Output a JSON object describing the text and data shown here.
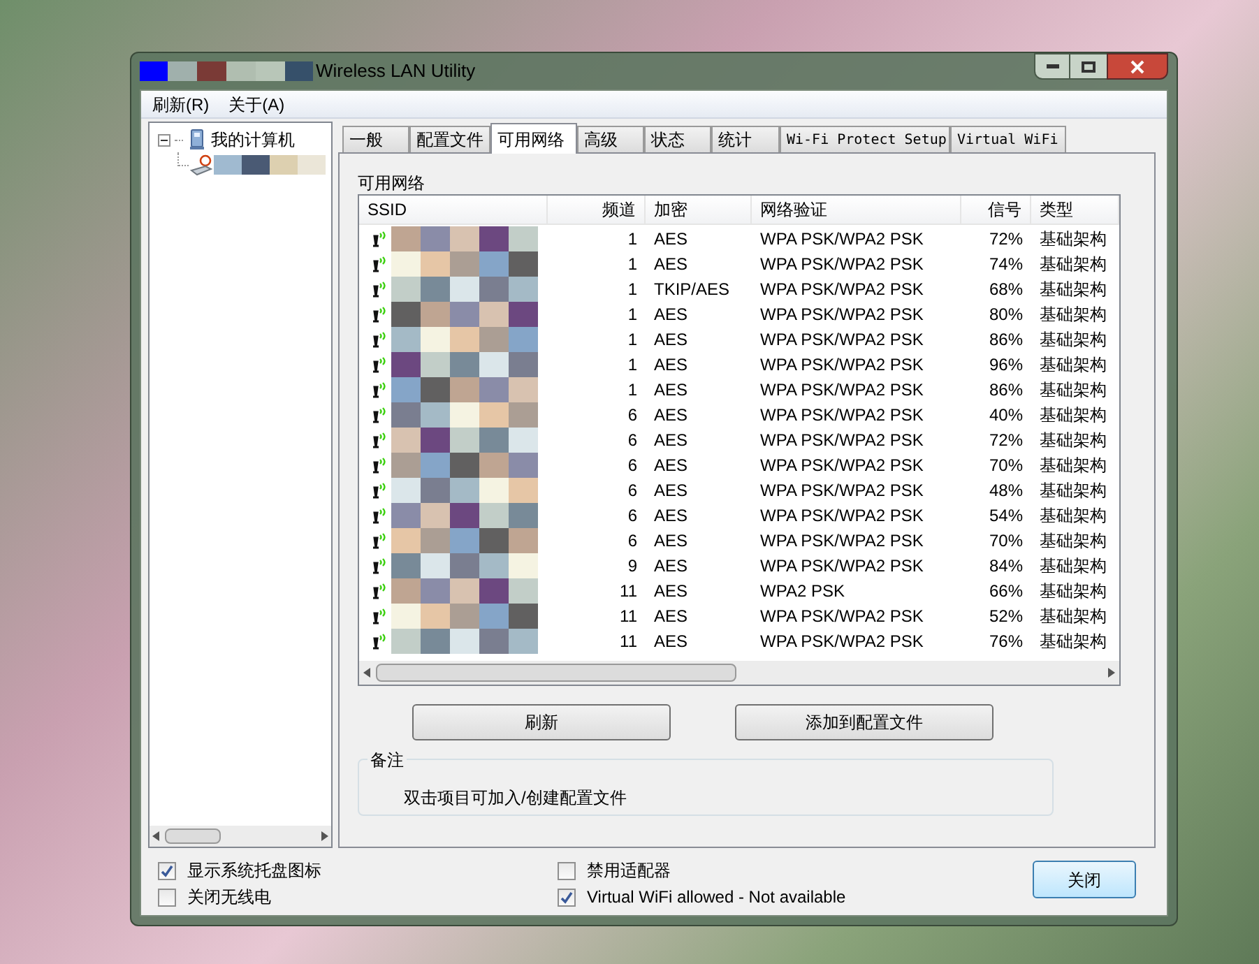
{
  "window": {
    "title": "Wireless LAN Utility"
  },
  "menu": [
    {
      "label": "刷新(R)"
    },
    {
      "label": "关于(A)"
    }
  ],
  "tree": {
    "label": "我的计算机",
    "expanded": true,
    "children": [
      {
        "kind": "adapter"
      }
    ]
  },
  "tabs": [
    {
      "label": "一般",
      "selected": false
    },
    {
      "label": "配置文件",
      "selected": false
    },
    {
      "label": "可用网络",
      "selected": true
    },
    {
      "label": "高级",
      "selected": false
    },
    {
      "label": "状态",
      "selected": false
    },
    {
      "label": "统计",
      "selected": false
    },
    {
      "label": "Wi-Fi Protect Setup",
      "selected": false
    },
    {
      "label": "Virtual WiFi",
      "selected": false
    }
  ],
  "panel_title": "可用网络",
  "table": {
    "columns": [
      "SSID",
      "频道",
      "加密",
      "网络验证",
      "信号",
      "类型"
    ],
    "rows": [
      {
        "channel": "1",
        "encryption": "AES",
        "auth": "WPA PSK/WPA2 PSK",
        "signal": "72%",
        "type": "基础架构"
      },
      {
        "channel": "1",
        "encryption": "AES",
        "auth": "WPA PSK/WPA2 PSK",
        "signal": "74%",
        "type": "基础架构"
      },
      {
        "channel": "1",
        "encryption": "TKIP/AES",
        "auth": "WPA PSK/WPA2 PSK",
        "signal": "68%",
        "type": "基础架构"
      },
      {
        "channel": "1",
        "encryption": "AES",
        "auth": "WPA PSK/WPA2 PSK",
        "signal": "80%",
        "type": "基础架构"
      },
      {
        "channel": "1",
        "encryption": "AES",
        "auth": "WPA PSK/WPA2 PSK",
        "signal": "86%",
        "type": "基础架构"
      },
      {
        "channel": "1",
        "encryption": "AES",
        "auth": "WPA PSK/WPA2 PSK",
        "signal": "96%",
        "type": "基础架构"
      },
      {
        "channel": "1",
        "encryption": "AES",
        "auth": "WPA PSK/WPA2 PSK",
        "signal": "86%",
        "type": "基础架构"
      },
      {
        "channel": "6",
        "encryption": "AES",
        "auth": "WPA PSK/WPA2 PSK",
        "signal": "40%",
        "type": "基础架构"
      },
      {
        "channel": "6",
        "encryption": "AES",
        "auth": "WPA PSK/WPA2 PSK",
        "signal": "72%",
        "type": "基础架构"
      },
      {
        "channel": "6",
        "encryption": "AES",
        "auth": "WPA PSK/WPA2 PSK",
        "signal": "70%",
        "type": "基础架构"
      },
      {
        "channel": "6",
        "encryption": "AES",
        "auth": "WPA PSK/WPA2 PSK",
        "signal": "48%",
        "type": "基础架构"
      },
      {
        "channel": "6",
        "encryption": "AES",
        "auth": "WPA PSK/WPA2 PSK",
        "signal": "54%",
        "type": "基础架构"
      },
      {
        "channel": "6",
        "encryption": "AES",
        "auth": "WPA PSK/WPA2 PSK",
        "signal": "70%",
        "type": "基础架构"
      },
      {
        "channel": "9",
        "encryption": "AES",
        "auth": "WPA PSK/WPA2 PSK",
        "signal": "84%",
        "type": "基础架构"
      },
      {
        "channel": "11",
        "encryption": "AES",
        "auth": "WPA2 PSK",
        "signal": "66%",
        "type": "基础架构"
      },
      {
        "channel": "11",
        "encryption": "AES",
        "auth": "WPA PSK/WPA2 PSK",
        "signal": "52%",
        "type": "基础架构"
      },
      {
        "channel": "11",
        "encryption": "AES",
        "auth": "WPA PSK/WPA2 PSK",
        "signal": "76%",
        "type": "基础架构"
      }
    ]
  },
  "buttons": [
    "刷新",
    "添加到配置文件"
  ],
  "note": {
    "title": "备注",
    "text": "双击项目可加入/创建配置文件"
  },
  "options": [
    {
      "label": "显示系统托盘图标",
      "checked": true
    },
    {
      "label": "关闭无线电",
      "checked": false
    },
    {
      "label": "禁用适配器",
      "checked": false
    },
    {
      "label": "Virtual WiFi allowed - Not available",
      "checked": true
    }
  ],
  "close_button": "关闭"
}
